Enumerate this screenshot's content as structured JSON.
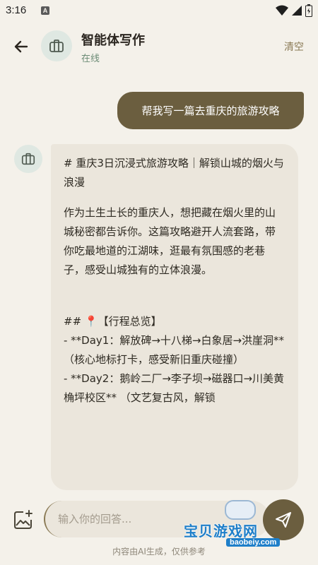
{
  "status": {
    "time": "3:16",
    "a_badge": "A"
  },
  "header": {
    "title": "智能体写作",
    "subtitle": "在线",
    "clear_label": "清空"
  },
  "chat": {
    "user_message": "帮我写一篇去重庆的旅游攻略",
    "bot_lines": {
      "title": "# 重庆3日沉浸式旅游攻略｜解锁山城的烟火与浪漫",
      "intro": "作为土生土长的重庆人，想把藏在烟火里的山城秘密都告诉你。这篇攻略避开人流套路，带你吃最地道的江湖味，逛最有氛围感的老巷子，感受山城独有的立体浪漫。",
      "section": "## 📍【行程总览】",
      "day1": "- **Day1：解放碑→十八梯→白象居→洪崖洞** （核心地标打卡，感受新旧重庆碰撞）",
      "day2": "- **Day2：鹅岭二厂→李子坝→磁器口→川美黄桷坪校区** （文艺复古风，解锁"
    }
  },
  "composer": {
    "placeholder": "输入你的回答...",
    "disclaimer": "内容由AI生成，仅供参考"
  },
  "watermark": {
    "text": "宝贝游戏网",
    "url": "baobeiy.com"
  },
  "colors": {
    "accent": "#6b5e3f",
    "background": "#f4f1ea",
    "bubble": "#ebe6dc",
    "online": "#6c8c76"
  },
  "icons": {
    "back": "arrow-left-icon",
    "avatar": "briefcase-icon",
    "image_add": "image-add-icon",
    "send": "send-icon"
  }
}
